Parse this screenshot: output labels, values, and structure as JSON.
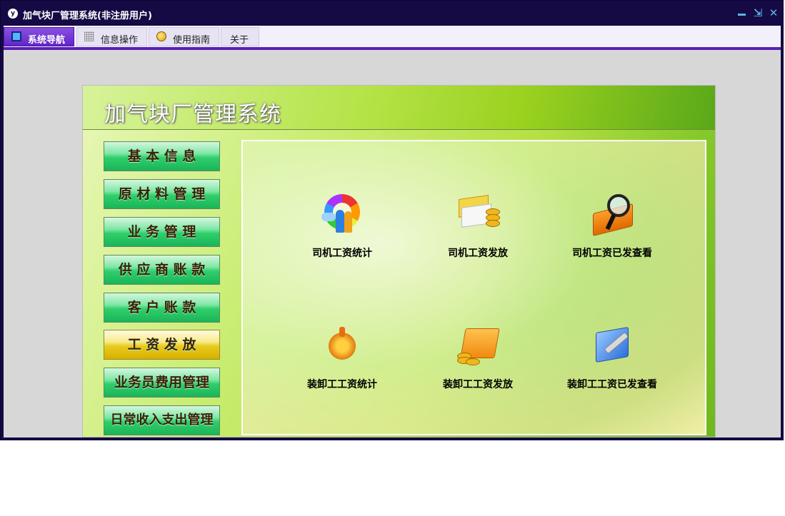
{
  "window": {
    "title": "加气块厂管理系统(非注册用户)",
    "app_icon": "app-logo-icon"
  },
  "tabs": [
    {
      "label": "系统导航",
      "icon": "monitor-icon",
      "active": true
    },
    {
      "label": "信息操作",
      "icon": "grid-icon",
      "active": false
    },
    {
      "label": "使用指南",
      "icon": "guide-icon",
      "active": false
    },
    {
      "label": "关于",
      "active": false
    }
  ],
  "panel": {
    "title": "加气块厂管理系统"
  },
  "menu": [
    {
      "label": "基 本 信 息",
      "selected": false
    },
    {
      "label": "原 材 料 管 理",
      "selected": false
    },
    {
      "label": "业 务 管 理",
      "selected": false
    },
    {
      "label": "供 应 商 账 款",
      "selected": false
    },
    {
      "label": "客 户 账 款",
      "selected": false
    },
    {
      "label": "工 资 发 放",
      "selected": true
    },
    {
      "label": "业务员费用管理",
      "selected": false
    },
    {
      "label": "日常收入支出管理",
      "selected": false
    }
  ],
  "functions": [
    {
      "label": "司机工资统计",
      "icon": "rainbow-people-icon"
    },
    {
      "label": "司机工资发放",
      "icon": "card-coins-icon"
    },
    {
      "label": "司机工资已发查看",
      "icon": "magnifier-book-icon"
    },
    {
      "label": "装卸工工资统计",
      "icon": "gear-hand-icon"
    },
    {
      "label": "装卸工工资发放",
      "icon": "folder-coins-icon"
    },
    {
      "label": "装卸工工资已发查看",
      "icon": "book-wrench-icon"
    }
  ],
  "colors": {
    "titlebar": "#150a44",
    "tab_active": "#6226c8",
    "menu_green": "#2fcf6a",
    "menu_selected": "#e8cb1e"
  }
}
